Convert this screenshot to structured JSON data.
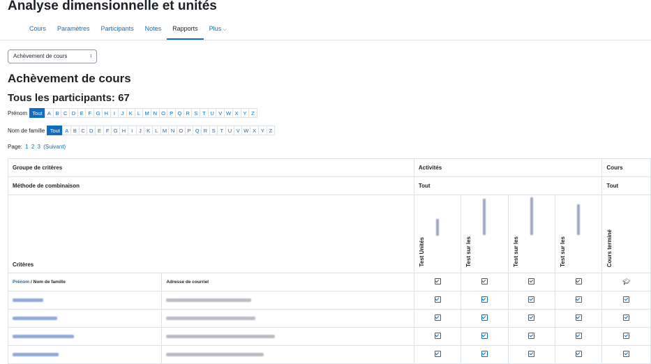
{
  "page": {
    "title": "Analyse dimensionnelle et unités"
  },
  "nav": {
    "items": [
      "Cours",
      "Paramètres",
      "Participants",
      "Notes",
      "Rapports",
      "Plus"
    ],
    "active": "Rapports",
    "more_icon": "chevron-down-icon"
  },
  "report_select": {
    "value": "Achèvement de cours",
    "icon": "sort-arrows-icon"
  },
  "report": {
    "title": "Achèvement de cours",
    "participants": "Tous les participants: 67"
  },
  "filters": {
    "firstname_label": "Prénom",
    "lastname_label": "Nom de famille",
    "all_label": "Tout",
    "letters": [
      "A",
      "B",
      "C",
      "D",
      "E",
      "F",
      "G",
      "H",
      "I",
      "J",
      "K",
      "L",
      "M",
      "N",
      "O",
      "P",
      "Q",
      "R",
      "S",
      "T",
      "U",
      "V",
      "W",
      "X",
      "Y",
      "Z"
    ]
  },
  "paging": {
    "label": "Page:",
    "pages": [
      "1",
      "2",
      "3"
    ],
    "next": "(Suivant)"
  },
  "table": {
    "row_labels": {
      "group": "Groupe de critères",
      "method": "Méthode de combinaison",
      "criteria": "Critères"
    },
    "activities_header": "Activités",
    "activities_method": "Tout",
    "course_header": "Cours",
    "course_method": "Tout",
    "criteria_columns": [
      "Test Unités",
      "Test sur les",
      "Test sur les",
      "Test sur les"
    ],
    "course_column": "Cours terminé",
    "col_header_firstname": "Prénom",
    "col_header_sep": " / ",
    "col_header_lastname": "Nom de famille",
    "col_header_email": "Adresse de courriel",
    "icons": {
      "activity": "checkbox-icon",
      "course": "graduation-cap-icon"
    },
    "accent_color": "#0f6cbf",
    "rows_visible": 4
  }
}
